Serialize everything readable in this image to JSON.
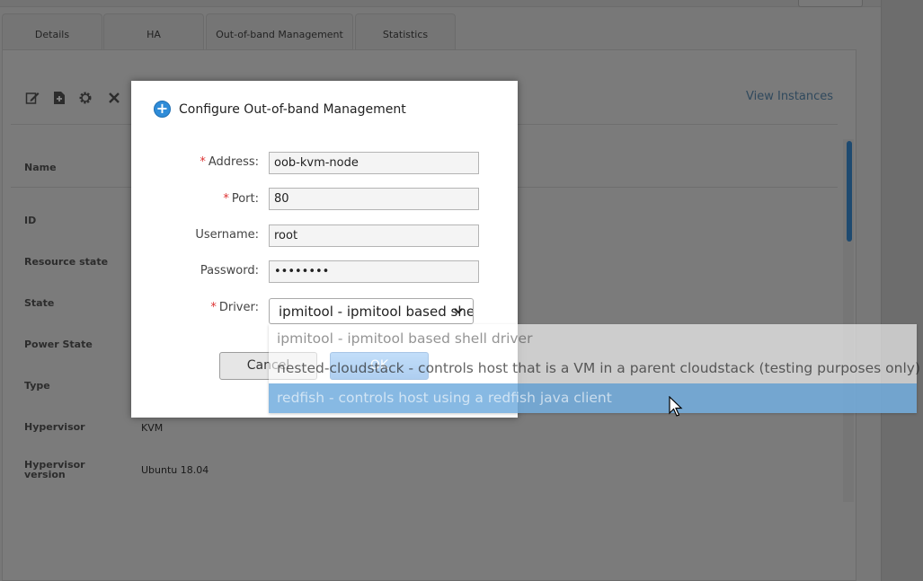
{
  "tabs": [
    {
      "label": "Details"
    },
    {
      "label": "HA"
    },
    {
      "label": "Out-of-band Management"
    },
    {
      "label": "Statistics"
    }
  ],
  "actions": {
    "view_instances": "View Instances",
    "icons": [
      "edit-icon",
      "add-document-icon",
      "settings-icon",
      "close-icon"
    ]
  },
  "details": {
    "fields": [
      {
        "label": "Name",
        "value": ""
      },
      {
        "label": "ID",
        "value": ""
      },
      {
        "label": "Resource state",
        "value": ""
      },
      {
        "label": "State",
        "value": ""
      },
      {
        "label": "Power State",
        "value": ""
      },
      {
        "label": "Type",
        "value": ""
      },
      {
        "label": "Hypervisor",
        "value": "KVM"
      },
      {
        "label": "Hypervisor version",
        "value": "Ubuntu 18.04"
      }
    ]
  },
  "dialog": {
    "title": "Configure Out-of-band Management",
    "icon": "plus-circle-icon",
    "required_mark": "*",
    "fields": {
      "address": {
        "label": "Address:",
        "value": "oob-kvm-node",
        "required": true
      },
      "port": {
        "label": "Port:",
        "value": "80",
        "required": true
      },
      "username": {
        "label": "Username:",
        "value": "root",
        "required": false
      },
      "password": {
        "label": "Password:",
        "value": "••••••••",
        "required": false
      },
      "driver": {
        "label": "Driver:",
        "value": "ipmitool - ipmitool based shell driver",
        "required": true
      }
    },
    "buttons": {
      "cancel": "Cancel",
      "ok": "OK"
    }
  },
  "driver_options": [
    "ipmitool - ipmitool based shell driver",
    "nested-cloudstack - controls host that is a VM in a parent cloudstack (testing purposes only)",
    "redfish - controls host using a redfish java client"
  ],
  "highlighted_option": "redfish - controls host using a redfish java client",
  "colors": {
    "accent": "#2f8cd8",
    "required": "#d33333",
    "link": "#5d8db3",
    "selection": "#3d8ed2"
  }
}
